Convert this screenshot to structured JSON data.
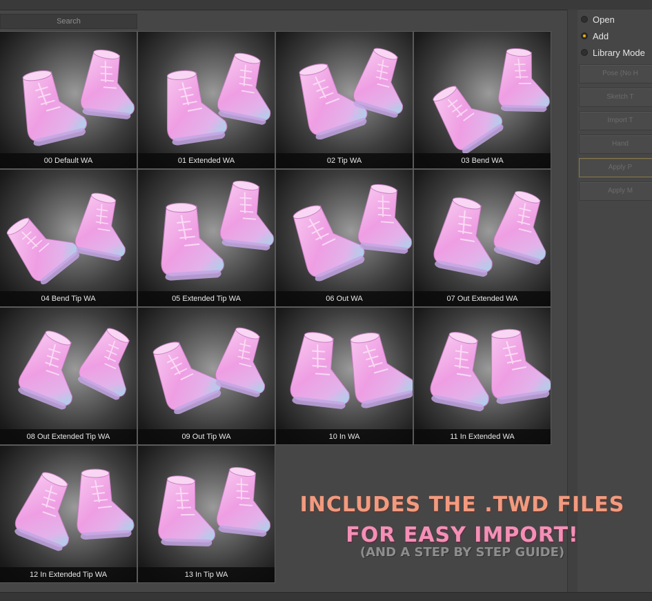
{
  "search": {
    "placeholder": "Search"
  },
  "poses": [
    "00 Default WA",
    "01 Extended WA",
    "02 Tip WA",
    "03 Bend WA",
    "04 Bend Tip WA",
    "05 Extended Tip WA",
    "06 Out WA",
    "07 Out Extended WA",
    "08 Out Extended Tip WA",
    "09 Out Tip WA",
    "10 In WA",
    "11 In Extended WA",
    "12 In Extended Tip WA",
    "13 In Tip WA"
  ],
  "panel": {
    "options": [
      {
        "label": "Open",
        "selected": false
      },
      {
        "label": "Add",
        "selected": true
      },
      {
        "label": "Library Mode",
        "selected": false
      }
    ],
    "buttons": [
      "Pose (No H",
      "Sketch T",
      "Import T",
      "Hand",
      "Apply P",
      "Apply M"
    ]
  },
  "promo": {
    "line1": "INCLUDES THE .TWD FILES",
    "line2": "FOR EASY IMPORT!",
    "line3": "(AND A STEP BY STEP GUIDE)"
  },
  "colors": {
    "accent": "#f0b400",
    "boot_pink": "#f2a6e6",
    "boot_cyan": "#7fd8e6",
    "promo_orange": "#f39a7e",
    "promo_pink": "#f58fb6"
  }
}
